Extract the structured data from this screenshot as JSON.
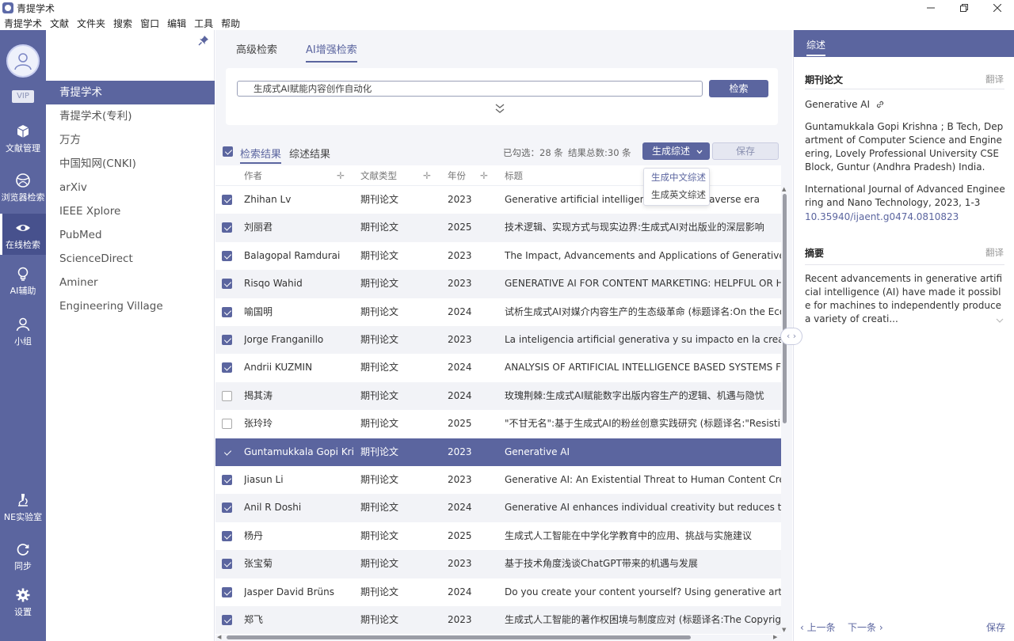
{
  "window": {
    "title": "青提学术",
    "controls": [
      "minimize",
      "maximize",
      "close"
    ]
  },
  "menu": [
    "青提学术",
    "文献",
    "文件夹",
    "搜索",
    "窗口",
    "编辑",
    "工具",
    "帮助"
  ],
  "rail": {
    "vip": "VIP",
    "items": [
      {
        "label": "文献管理",
        "icon": "box-icon"
      },
      {
        "label": "浏览器检索",
        "icon": "globe-icon"
      },
      {
        "label": "在线检索",
        "icon": "eye-icon"
      },
      {
        "label": "AI辅助",
        "icon": "lightbulb-icon"
      },
      {
        "label": "小组",
        "icon": "group-icon"
      },
      {
        "label": "NE实验室",
        "icon": "microscope-icon"
      },
      {
        "label": "同步",
        "icon": "sync-icon"
      },
      {
        "label": "设置",
        "icon": "gear-icon"
      }
    ]
  },
  "sources": [
    "青提学术",
    "青提学术(专利)",
    "万方",
    "中国知网(CNKI)",
    "arXiv",
    "IEEE Xplore",
    "PubMed",
    "ScienceDirect",
    "Aminer",
    "Engineering Village"
  ],
  "tabs": [
    "高级检索",
    "AI增强检索"
  ],
  "search": {
    "value": "生成式AI赋能内容创作自动化",
    "button": "检索"
  },
  "results": {
    "tab_results": "检索结果",
    "tab_summary": "综述结果",
    "selected": "已勾选：28 条",
    "total": "结果总数:30 条",
    "generate": "生成综述",
    "save": "保存",
    "dropdown": [
      "生成中文综述",
      "生成英文综述"
    ],
    "columns": [
      "作者",
      "文献类型",
      "年份",
      "标题"
    ],
    "rows": [
      {
        "checked": true,
        "author": "Zhihan Lv",
        "type": "期刊论文",
        "year": "2023",
        "title": "Generative artificial intelligence in the metaverse era"
      },
      {
        "checked": true,
        "author": "刘丽君",
        "type": "期刊论文",
        "year": "2025",
        "title": "技术逻辑、实现方式与现实边界:生成式AI对出版业的深层影响"
      },
      {
        "checked": true,
        "author": "Balagopal Ramdurai",
        "type": "期刊论文",
        "year": "2023",
        "title": "The Impact, Advancements and Applications of Generative AI"
      },
      {
        "checked": true,
        "author": "Risqo Wahid",
        "type": "期刊论文",
        "year": "2023",
        "title": "GENERATIVE AI FOR CONTENT MARKETING: HELPFUL OR HARMFUL"
      },
      {
        "checked": true,
        "author": "喻国明",
        "type": "期刊论文",
        "year": "2024",
        "title": "试析生成式AI对媒介内容生产的生态级革命 (标题译名:On the Ecological"
      },
      {
        "checked": true,
        "author": "Jorge Franganillo",
        "type": "期刊论文",
        "year": "2023",
        "title": "La inteligencia artificial generativa y su impacto en la creación de co"
      },
      {
        "checked": true,
        "author": "Andrii KUZMIN",
        "type": "期刊论文",
        "year": "2024",
        "title": "ANALYSIS OF ARTIFICIAL INTELLIGENCE BASED SYSTEMS FOR AUTO"
      },
      {
        "checked": false,
        "author": "揭其涛",
        "type": "期刊论文",
        "year": "2024",
        "title": "玫瑰荆棘:生成式AI赋能数字出版内容生产的逻辑、机遇与隐忧"
      },
      {
        "checked": false,
        "author": "张玲玲",
        "type": "期刊论文",
        "year": "2025",
        "title": "\"不甘无名\":基于生成式AI的粉丝创意实践研究 (标题译名:\"Resisting Obscu"
      },
      {
        "checked": true,
        "selected": true,
        "author": "Guntamukkala Gopi Krishna",
        "type": "期刊论文",
        "year": "2023",
        "title": "Generative AI"
      },
      {
        "checked": true,
        "author": "Jiasun Li",
        "type": "期刊论文",
        "year": "2023",
        "title": "Generative AI: An Existential Threat to Human Content Creators?"
      },
      {
        "checked": true,
        "author": "Anil R Doshi",
        "type": "期刊论文",
        "year": "2024",
        "title": "Generative AI enhances individual creativity but reduces the collectiv"
      },
      {
        "checked": true,
        "author": "杨丹",
        "type": "期刊论文",
        "year": "2025",
        "title": "生成式人工智能在中学化学教育中的应用、挑战与实施建议"
      },
      {
        "checked": true,
        "author": "张宝菊",
        "type": "期刊论文",
        "year": "2023",
        "title": "基于技术角度浅谈ChatGPT带来的机遇与发展"
      },
      {
        "checked": true,
        "author": "Jasper David Brüns",
        "type": "期刊论文",
        "year": "2024",
        "title": "Do you create your content yourself? Using generative artificial intel"
      },
      {
        "checked": true,
        "author": "郑飞",
        "type": "期刊论文",
        "year": "2023",
        "title": "生成式人工智能的著作权困境与制度应对 (标题译名:The Copyright Dilem"
      }
    ]
  },
  "detail": {
    "tab": "综述",
    "section1": "期刊论文",
    "translate": "翻译",
    "title": "Generative AI",
    "authors": "Guntamukkala Gopi Krishna ; B Tech, Department of Computer Science and Engineering, Lovely Professional University CSE Block, Guntur (Andhra Pradesh) India.",
    "journal": "International Journal of Advanced Engineering and Nano Technology, 2023, 1-3",
    "doi": "10.35940/ijaent.g0474.0810823",
    "section2": "摘要",
    "abstract": "Recent advancements in generative artificial intelligence (AI) have made it possible for machines to independently produce a variety of creati...",
    "prev": "上一条",
    "next": "下一条",
    "save": "保存"
  },
  "colors": {
    "accent": "#5b659f",
    "rail_active": "#47518d"
  }
}
